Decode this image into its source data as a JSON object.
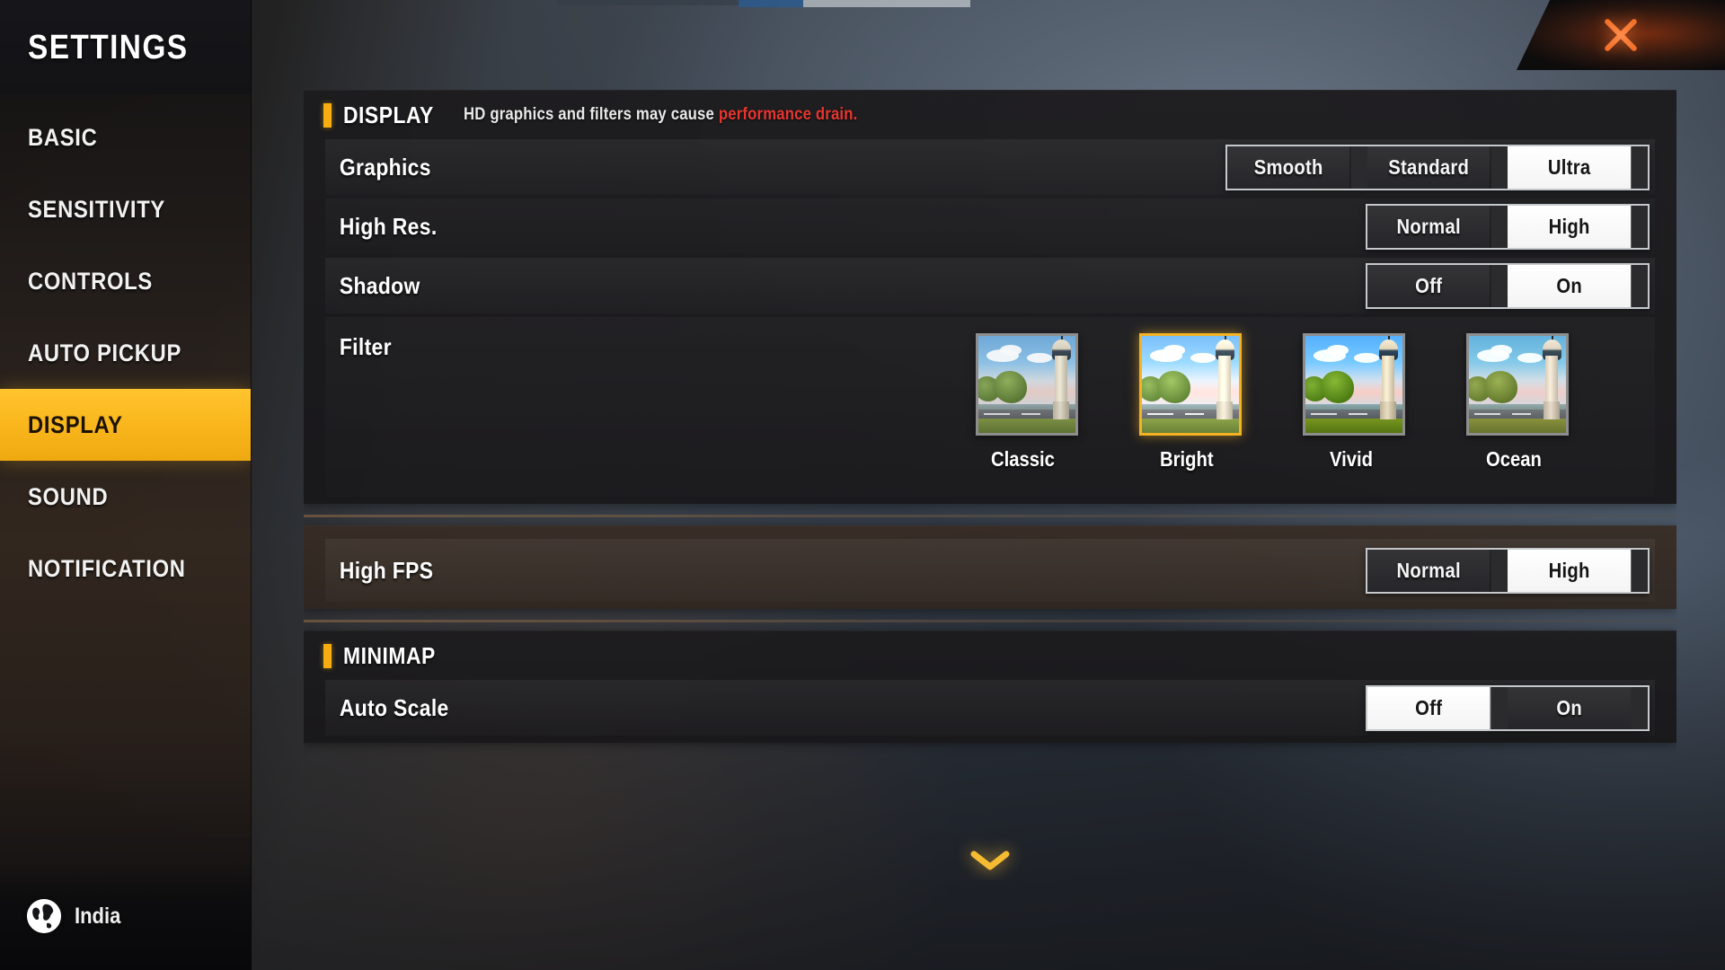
{
  "sidebar": {
    "title": "SETTINGS",
    "items": [
      {
        "label": "BASIC",
        "active": false
      },
      {
        "label": "SENSITIVITY",
        "active": false
      },
      {
        "label": "CONTROLS",
        "active": false
      },
      {
        "label": "AUTO PICKUP",
        "active": false
      },
      {
        "label": "DISPLAY",
        "active": true
      },
      {
        "label": "SOUND",
        "active": false
      },
      {
        "label": "NOTIFICATION",
        "active": false
      }
    ],
    "footer": {
      "region": "India",
      "icon": "globe-icon"
    }
  },
  "close_button": {
    "icon": "close-icon",
    "label": ""
  },
  "display_section": {
    "title": "DISPLAY",
    "note_text": "HD graphics and filters may cause ",
    "note_warning": "performance drain.",
    "rows": [
      {
        "label": "Graphics",
        "options": [
          "Smooth",
          "Standard",
          "Ultra"
        ],
        "selected": "Ultra"
      },
      {
        "label": "High Res.",
        "options": [
          "Normal",
          "High"
        ],
        "selected": "High"
      },
      {
        "label": "Shadow",
        "options": [
          "Off",
          "On"
        ],
        "selected": "On"
      }
    ],
    "filter_row": {
      "label": "Filter",
      "options": [
        {
          "name": "Classic",
          "selected": false,
          "variant": "classic"
        },
        {
          "name": "Bright",
          "selected": true,
          "variant": "bright"
        },
        {
          "name": "Vivid",
          "selected": false,
          "variant": "vivid"
        },
        {
          "name": "Ocean",
          "selected": false,
          "variant": "ocean"
        }
      ]
    }
  },
  "fps_section": {
    "rows": [
      {
        "label": "High FPS",
        "options": [
          "Normal",
          "High"
        ],
        "selected": "High"
      }
    ]
  },
  "minimap_section": {
    "title": "MINIMAP",
    "rows": [
      {
        "label": "Auto Scale",
        "options": [
          "Off",
          "On"
        ],
        "selected": "Off"
      }
    ]
  },
  "scroll_indicator": {
    "icon": "chevron-down-icon"
  },
  "colors": {
    "accent": "#f7ad0f",
    "accent_selected": "#ffc42e",
    "warning": "#e8362f",
    "selected_segment_bg": "#ffffff",
    "segment_bg": "#2b2b2d",
    "segment_border": "#c6c9cc",
    "filter_selected_border": "#f5b223",
    "close_icon": "#f06c24"
  }
}
